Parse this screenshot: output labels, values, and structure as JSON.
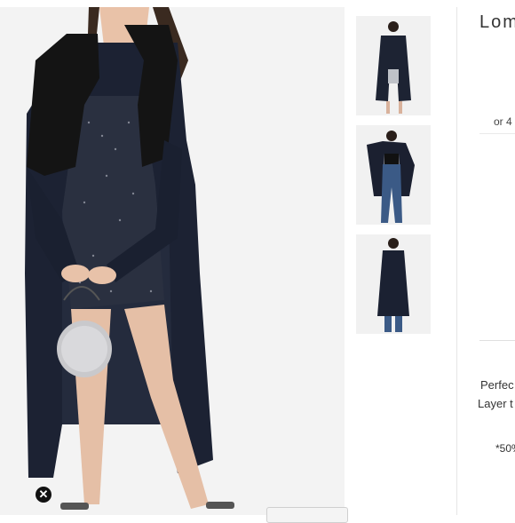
{
  "product": {
    "title": "Lom",
    "installments_text": "or 4",
    "description_line_1": "Perfec",
    "description_line_2": "Layer t",
    "fabric_text": "*50%"
  },
  "gallery": {
    "main_image_alt": "Model wearing long dark knit duster cardigan with faux fur collar over sparkly mini dress",
    "thumbnails": [
      {
        "alt": "Front view of long cardigan"
      },
      {
        "alt": "Cardigan worn with jeans"
      },
      {
        "alt": "Back view of long cardigan"
      }
    ]
  },
  "controls": {
    "close_symbol": "✕",
    "bottom_button_label": ""
  },
  "colors": {
    "coat": "#1b2233",
    "fur": "#151515",
    "dress": "#262b3a",
    "denim": "#3b5a86",
    "background": "#f3f3f3"
  }
}
